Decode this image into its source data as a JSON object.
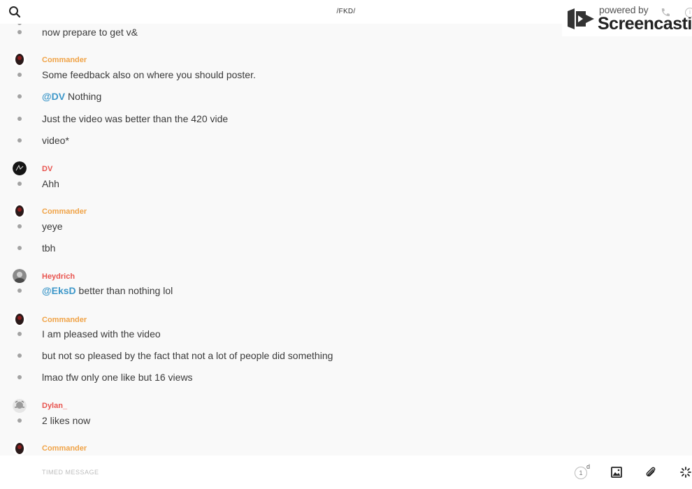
{
  "header": {
    "channel_title": "/FKD/"
  },
  "watermark": {
    "powered_by": "powered by",
    "brand": "Screencastify"
  },
  "messages": [
    {
      "id": "m0",
      "text": "now prepare to get v&"
    },
    {
      "id": "m1",
      "user": "Commander",
      "text": "Some feedback also on where you should poster."
    },
    {
      "id": "m2",
      "mention": "@DV",
      "text": " Nothing"
    },
    {
      "id": "m3",
      "text": "Just the video was better than the 420 vide"
    },
    {
      "id": "m4",
      "text": "video*"
    },
    {
      "id": "m5",
      "user": "DV",
      "text": "Ahh"
    },
    {
      "id": "m6",
      "user": "Commander",
      "text": "yeye"
    },
    {
      "id": "m7",
      "text": "tbh"
    },
    {
      "id": "m8",
      "user": "Heydrich",
      "mention": "@EksD",
      "text": " better than nothing lol"
    },
    {
      "id": "m9",
      "user": "Commander",
      "text": "I am pleased with the video"
    },
    {
      "id": "m10",
      "text": "but not so pleased by the fact that not a lot of people did something"
    },
    {
      "id": "m11",
      "text": "lmao tfw only one like but 16 views"
    },
    {
      "id": "m12",
      "user": "Dylan_",
      "text": "2 likes now"
    },
    {
      "id": "m13",
      "user": "Commander"
    }
  ],
  "composer": {
    "placeholder": "TIMED MESSAGE",
    "timer_value": "1",
    "timer_unit": "d"
  },
  "colors": {
    "commander": "#f0a347",
    "other_user": "#e8544f",
    "mention": "#3d97c9",
    "bullet": "#a3a3a3",
    "background": "#f9f9f9"
  },
  "icons": [
    "search-icon",
    "phone-icon",
    "info-icon",
    "timer-icon",
    "image-icon",
    "paperclip-icon",
    "loading-icon"
  ]
}
